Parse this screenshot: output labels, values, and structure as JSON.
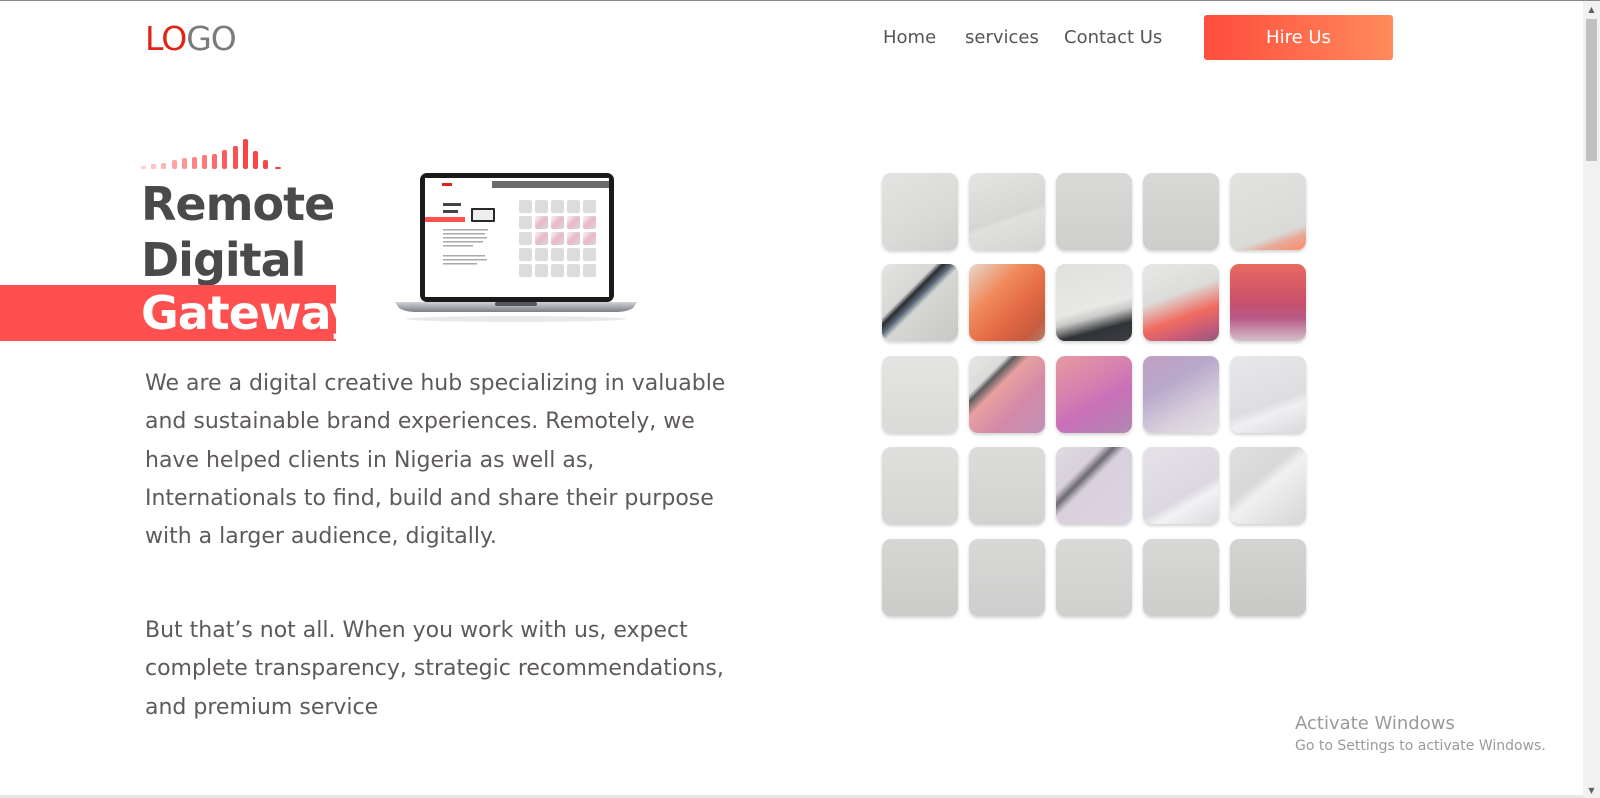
{
  "header": {
    "logo_part1": "LO",
    "logo_part2": "GO",
    "nav": {
      "home": "Home",
      "services": "services",
      "contact": "Contact Us"
    },
    "hire_button": "Hire Us"
  },
  "hero": {
    "title_line1": "Remote",
    "title_line2": "Digital",
    "title_line3": "Gateway",
    "paragraph1": "We are a digital creative hub specializing in valuable and sustainable brand experiences. Remotely, we have helped clients in Nigeria as well as, Internationals to find, build and share their purpose with a larger audience, digitally.",
    "paragraph2": "But that’s not all. When you work with us, expect complete transparency, strategic recommendations, and premium service"
  },
  "watermark": {
    "title": "Activate Windows",
    "subtitle": "Go to Settings to activate Windows."
  },
  "colors": {
    "accent": "#ff4f4f",
    "logo_red": "#e2231a",
    "text": "#5f5a5a",
    "hire_gradient_start": "#ff4d3d",
    "hire_gradient_end": "#ff8a5b"
  },
  "icons": {
    "sound_bars": "sound-wave-icon",
    "laptop": "laptop-mockup-image",
    "scroll_up": "scroll-up-arrow-icon",
    "scroll_down": "scroll-down-arrow-icon"
  }
}
